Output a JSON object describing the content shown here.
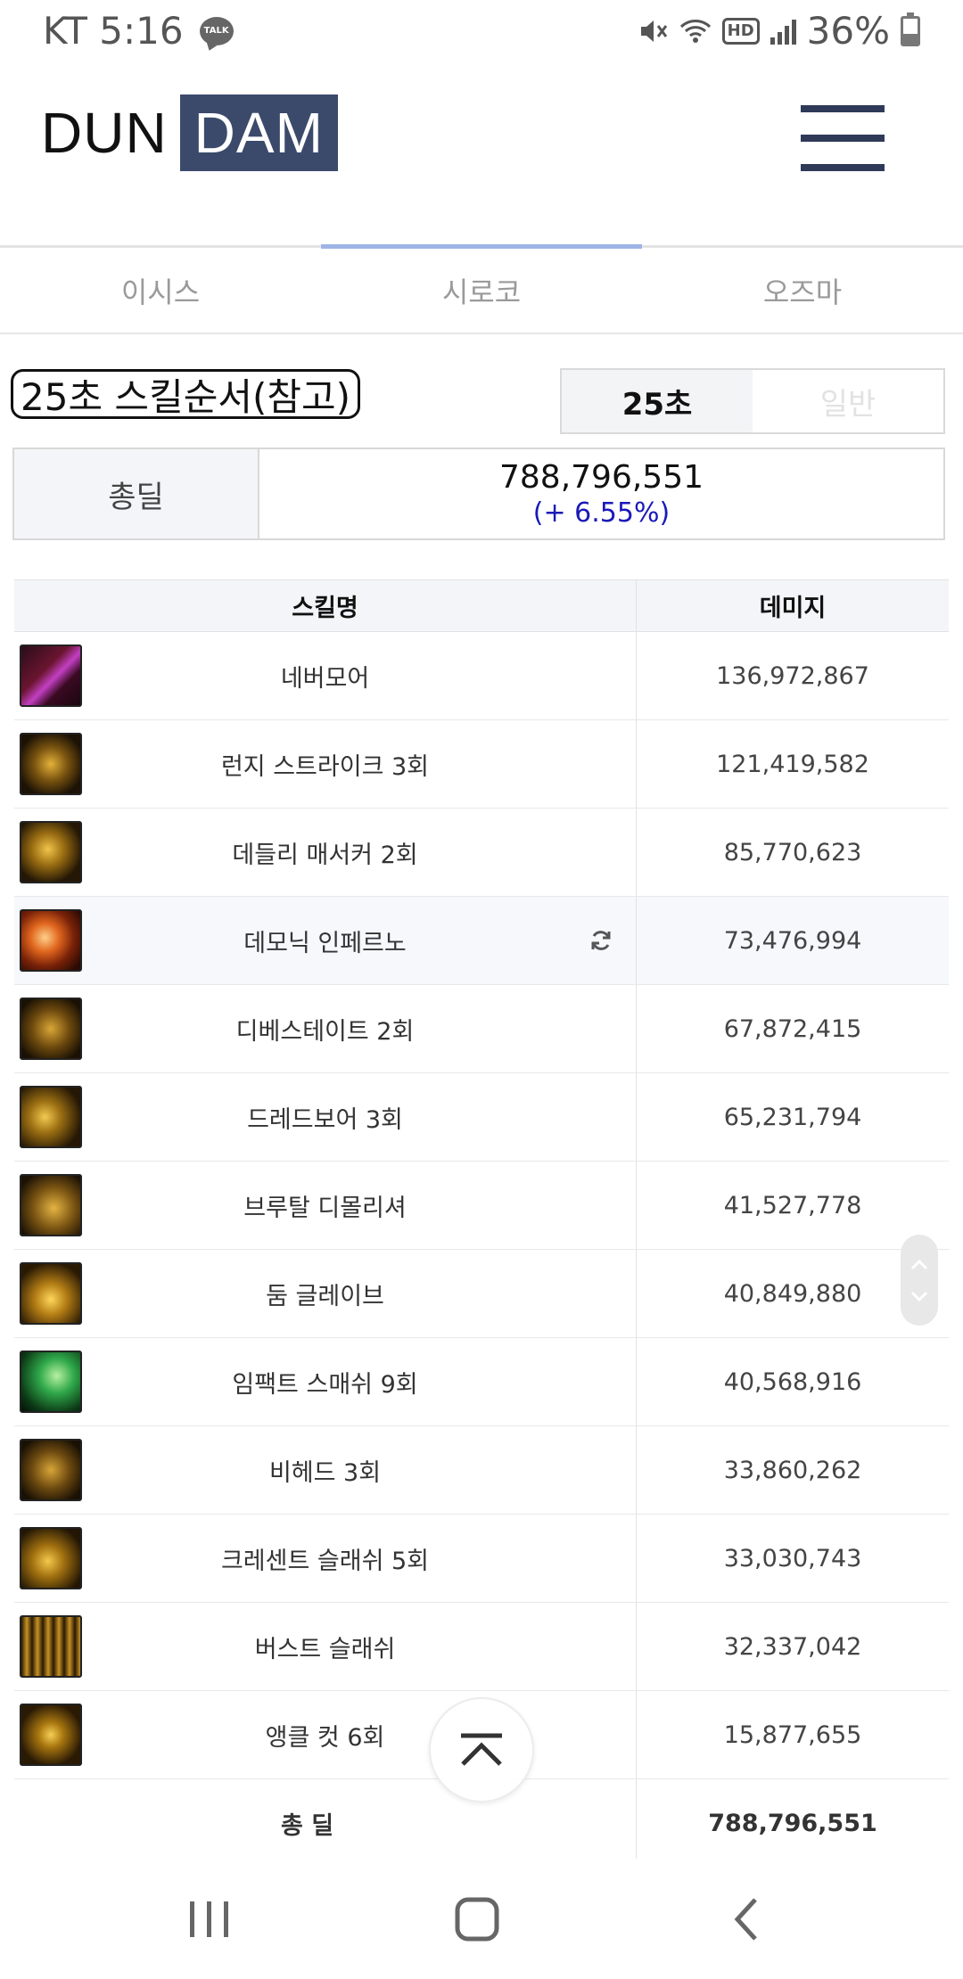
{
  "status_bar": {
    "carrier_time": "KT 5:16",
    "talk_badge": "TALK",
    "hd_label": "HD",
    "battery": "36%"
  },
  "header": {
    "logo_left": "DUN",
    "logo_right": "DAM"
  },
  "tabs": [
    {
      "label": "이시스",
      "active": false
    },
    {
      "label": "시로코",
      "active": true
    },
    {
      "label": "오즈마",
      "active": false
    }
  ],
  "section": {
    "title": "25초 스킬순서(참고)",
    "toggle": {
      "selected": "25초",
      "other": "일반"
    }
  },
  "total": {
    "label": "총딜",
    "value": "788,796,551",
    "change": "(+ 6.55%)"
  },
  "table": {
    "headers": {
      "skill": "스킬명",
      "damage": "데미지"
    },
    "rows": [
      {
        "name": "네버모어",
        "damage": "136,972,867",
        "icon": "nevermore-icon"
      },
      {
        "name": "런지 스트라이크 3회",
        "damage": "121,419,582",
        "icon": "lunge-strike-icon"
      },
      {
        "name": "데들리 매서커 2회",
        "damage": "85,770,623",
        "icon": "deadly-massacre-icon"
      },
      {
        "name": "데모닉 인페르노",
        "damage": "73,476,994",
        "icon": "demonic-inferno-icon"
      },
      {
        "name": "디베스테이트 2회",
        "damage": "67,872,415",
        "icon": "devastate-icon"
      },
      {
        "name": "드레드보어 3회",
        "damage": "65,231,794",
        "icon": "dreadbore-icon"
      },
      {
        "name": "브루탈 디몰리셔",
        "damage": "41,527,778",
        "icon": "brutal-demolisher-icon"
      },
      {
        "name": "둠 글레이브",
        "damage": "40,849,880",
        "icon": "doom-glaive-icon"
      },
      {
        "name": "임팩트 스매쉬 9회",
        "damage": "40,568,916",
        "icon": "impact-smash-icon"
      },
      {
        "name": "비헤드 3회",
        "damage": "33,860,262",
        "icon": "behead-icon"
      },
      {
        "name": "크레센트 슬래쉬 5회",
        "damage": "33,030,743",
        "icon": "crescent-slash-icon"
      },
      {
        "name": "버스트 슬래쉬",
        "damage": "32,337,042",
        "icon": "burst-slash-icon"
      },
      {
        "name": "앵클 컷 6회",
        "damage": "15,877,655",
        "icon": "ankle-cut-icon"
      }
    ],
    "total_row": {
      "label": "총 딜",
      "value": "788,796,551"
    }
  },
  "colors": {
    "logo_dark": "#3b4a6b",
    "tab_indicator": "#9fb4e6",
    "percent_text": "#1a1ab8",
    "header_bg": "#f4f5f8"
  }
}
